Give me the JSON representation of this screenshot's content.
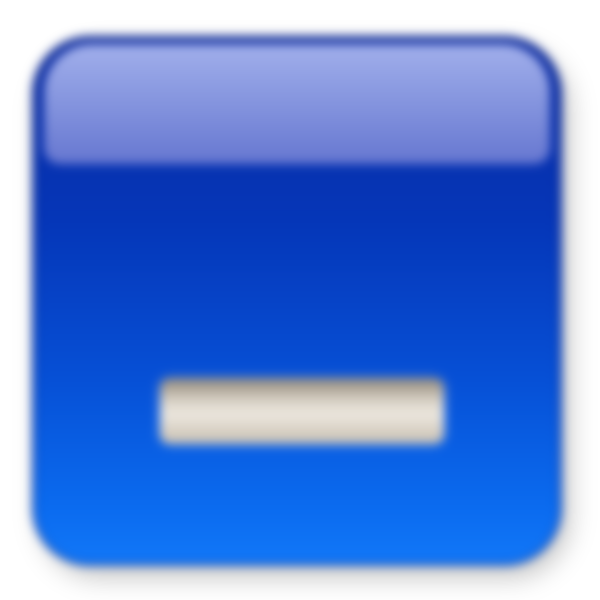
{
  "icon": {
    "name": "minus-button",
    "symbol": "minus-icon",
    "colors": {
      "base_top": "#0a2aa0",
      "base_bottom": "#1278f8",
      "gloss": "#a9b6ef",
      "bar_light": "#ece7de",
      "bar_dark": "#8f8678"
    }
  }
}
